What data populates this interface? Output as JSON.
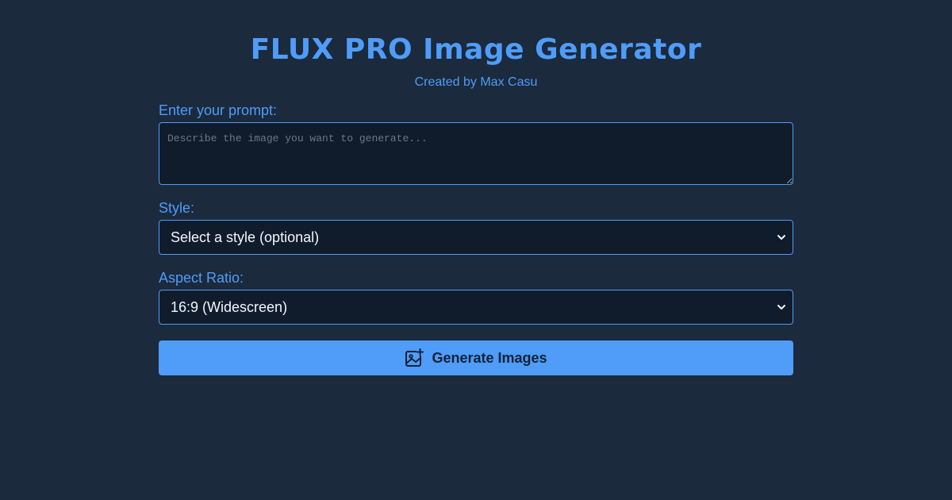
{
  "header": {
    "title": "FLUX PRO Image Generator",
    "subtitle": "Created by Max Casu"
  },
  "form": {
    "prompt": {
      "label": "Enter your prompt:",
      "placeholder": "Describe the image you want to generate...",
      "value": ""
    },
    "style": {
      "label": "Style:",
      "selected": "Select a style (optional)"
    },
    "aspect_ratio": {
      "label": "Aspect Ratio:",
      "selected": "16:9 (Widescreen)"
    },
    "generate_button": {
      "label": "Generate Images",
      "icon": "image-plus-icon"
    }
  },
  "colors": {
    "background": "#1b2a3d",
    "accent": "#4f9cf9",
    "field_background": "#101c2c",
    "button_text": "#132236"
  }
}
